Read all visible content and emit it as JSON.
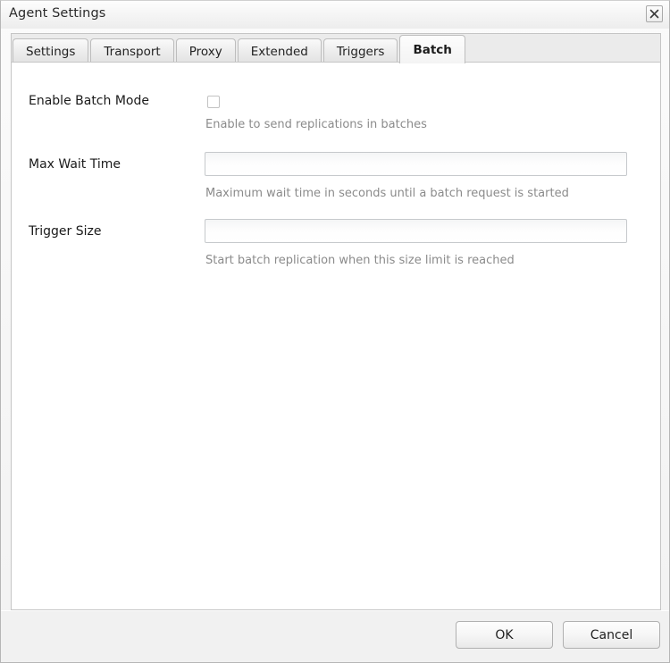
{
  "window": {
    "title": "Agent Settings",
    "close_icon": "close-icon"
  },
  "tabs": [
    {
      "label": "Settings",
      "active": false
    },
    {
      "label": "Transport",
      "active": false
    },
    {
      "label": "Proxy",
      "active": false
    },
    {
      "label": "Extended",
      "active": false
    },
    {
      "label": "Triggers",
      "active": false
    },
    {
      "label": "Batch",
      "active": true
    }
  ],
  "form": {
    "fields": [
      {
        "label": "Enable Batch Mode",
        "type": "checkbox",
        "checked": false,
        "help": "Enable to send replications in batches"
      },
      {
        "label": "Max Wait Time",
        "type": "text",
        "value": "",
        "placeholder": "",
        "help": "Maximum wait time in seconds until a batch request is started"
      },
      {
        "label": "Trigger Size",
        "type": "text",
        "value": "",
        "placeholder": "",
        "help": "Start batch replication when this size limit is reached"
      }
    ]
  },
  "footer": {
    "ok_label": "OK",
    "cancel_label": "Cancel"
  },
  "colors": {
    "window_background": "#f2f2f2",
    "panel_background": "#ffffff",
    "tabstrip_background": "#ebebeb",
    "border": "#c5c5c5",
    "label_text": "#1a1a1a",
    "help_text": "#8b8b8b",
    "footer_background": "#f1f1f1"
  }
}
